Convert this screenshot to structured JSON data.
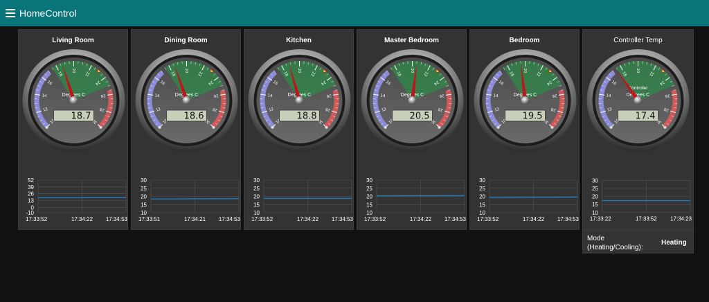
{
  "app": {
    "title": "HomeControl",
    "menu_icon": "hamburger-icon"
  },
  "gauge_scale": {
    "min": 10,
    "max": 30,
    "unit": "Degrees C",
    "ticks": [
      10,
      12,
      14,
      16,
      18,
      20,
      22,
      24,
      26,
      28,
      30
    ]
  },
  "chart_data": [
    {
      "type": "line",
      "title": "Living Room",
      "x": [
        "17:33:52",
        "17:34:22",
        "17:34:53"
      ],
      "yticks": [
        -10,
        0,
        13,
        26,
        39,
        52
      ],
      "ylim": [
        -10,
        52
      ],
      "series": [
        {
          "values": [
            18.5,
            18.6,
            18.7
          ]
        }
      ]
    },
    {
      "type": "line",
      "title": "Dining Room",
      "x": [
        "17:33:51",
        "17:34:21",
        "17:34:53"
      ],
      "yticks": [
        10,
        15,
        20,
        25,
        30
      ],
      "ylim": [
        10,
        30
      ],
      "series": [
        {
          "values": [
            18.4,
            18.5,
            18.6
          ]
        }
      ]
    },
    {
      "type": "line",
      "title": "Kitchen",
      "x": [
        "17:33:52",
        "17:34:22",
        "17:34:53"
      ],
      "yticks": [
        10,
        15,
        20,
        25,
        30
      ],
      "ylim": [
        10,
        30
      ],
      "series": [
        {
          "values": [
            18.8,
            18.8,
            18.8
          ]
        }
      ]
    },
    {
      "type": "line",
      "title": "Master Bedroom",
      "x": [
        "17:33:52",
        "17:34:22",
        "17:34:53"
      ],
      "yticks": [
        10,
        15,
        20,
        25,
        30
      ],
      "ylim": [
        10,
        30
      ],
      "series": [
        {
          "values": [
            20.3,
            20.4,
            20.5
          ]
        }
      ]
    },
    {
      "type": "line",
      "title": "Bedroom",
      "x": [
        "17:33:52",
        "17:34:22",
        "17:34:53"
      ],
      "yticks": [
        10,
        15,
        20,
        25,
        30
      ],
      "ylim": [
        10,
        30
      ],
      "series": [
        {
          "values": [
            19.3,
            19.4,
            19.5
          ]
        }
      ]
    },
    {
      "type": "line",
      "title": "Controller Temp",
      "x": [
        "17:33:22",
        "17:33:52",
        "17:34:23"
      ],
      "yticks": [
        10,
        15,
        20,
        25,
        30
      ],
      "ylim": [
        10,
        30
      ],
      "series": [
        {
          "values": [
            17.4,
            17.4,
            17.4
          ]
        }
      ]
    }
  ],
  "cards": [
    {
      "title": "Living Room",
      "value": "18.7",
      "reading": 18.7,
      "target": 23,
      "gauge_label": ""
    },
    {
      "title": "Dining Room",
      "value": "18.6",
      "reading": 18.6,
      "target": 23,
      "gauge_label": ""
    },
    {
      "title": "Kitchen",
      "value": "18.8",
      "reading": 18.8,
      "target": 23,
      "gauge_label": ""
    },
    {
      "title": "Master Bedroom",
      "value": "20.5",
      "reading": 20.5,
      "target": 23,
      "gauge_label": ""
    },
    {
      "title": "Bedroom",
      "value": "19.5",
      "reading": 19.5,
      "target": 23,
      "gauge_label": ""
    },
    {
      "title": "Controller Temp",
      "value": "17.4",
      "reading": 17.4,
      "target": 23,
      "gauge_label": "Controller"
    }
  ],
  "mode": {
    "label": "Mode\n(Heating/Cooling):",
    "value": "Heating"
  },
  "colors": {
    "topbar": "#097479",
    "card": "#333333",
    "line": "#1f77b4",
    "needle": "#c0141b",
    "cold_band": "#8b8bd8",
    "comfort_band": "#2f8a4a",
    "hot_band": "#d05a5a"
  }
}
